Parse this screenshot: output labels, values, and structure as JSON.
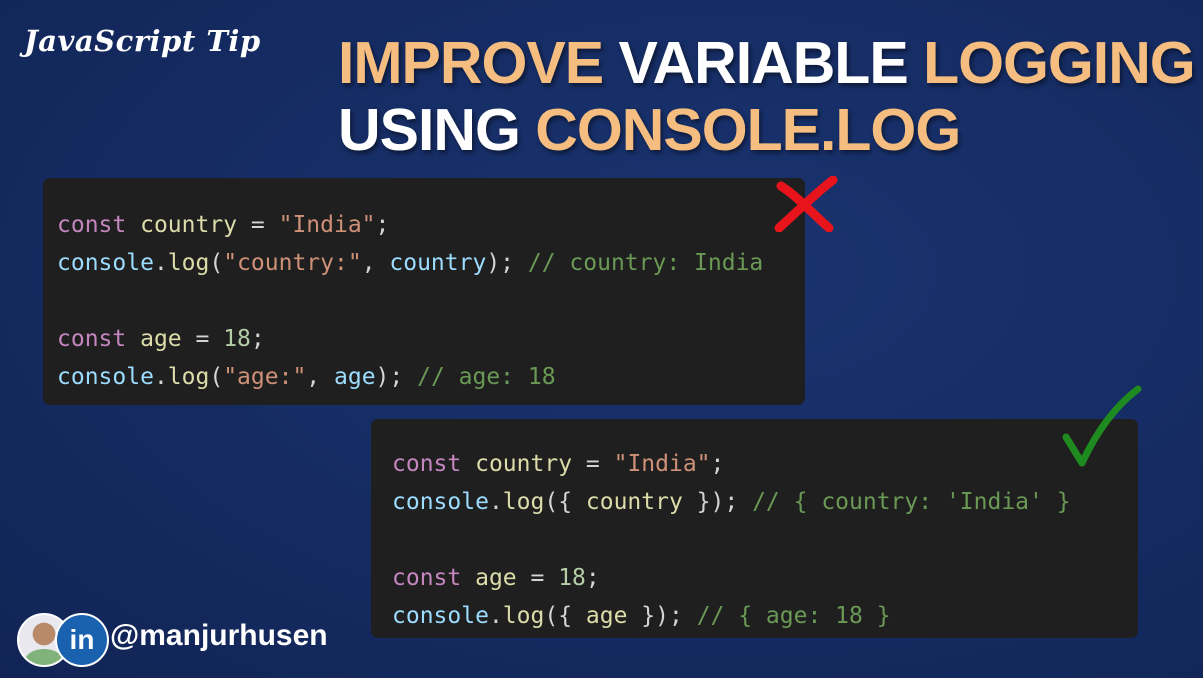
{
  "tag": "JavaScript Tip",
  "title": {
    "line1": [
      {
        "text": "IMPROVE ",
        "accent": true
      },
      {
        "text": "VARIABLE ",
        "accent": false
      },
      {
        "text": "LOGGING",
        "accent": true
      }
    ],
    "line2": [
      {
        "text": "USING ",
        "accent": false
      },
      {
        "text": "CONSOLE.LOG",
        "accent": true
      }
    ]
  },
  "bad_example": {
    "mark_icon": "red-cross-icon",
    "lines": [
      [
        [
          "kw",
          "const"
        ],
        [
          "pl",
          " "
        ],
        [
          "var",
          "country"
        ],
        [
          "pl",
          " = "
        ],
        [
          "str",
          "\"India\""
        ],
        [
          "pl",
          ";"
        ]
      ],
      [
        [
          "fn",
          "console"
        ],
        [
          "pl",
          "."
        ],
        [
          "var",
          "log"
        ],
        [
          "pl",
          "("
        ],
        [
          "str",
          "\"country:\""
        ],
        [
          "pl",
          ", "
        ],
        [
          "fn",
          "country"
        ],
        [
          "pl",
          "); "
        ],
        [
          "cm",
          "// country: India"
        ]
      ],
      [],
      [
        [
          "kw",
          "const"
        ],
        [
          "pl",
          " "
        ],
        [
          "var",
          "age"
        ],
        [
          "pl",
          " = "
        ],
        [
          "num",
          "18"
        ],
        [
          "pl",
          ";"
        ]
      ],
      [
        [
          "fn",
          "console"
        ],
        [
          "pl",
          "."
        ],
        [
          "var",
          "log"
        ],
        [
          "pl",
          "("
        ],
        [
          "str",
          "\"age:\""
        ],
        [
          "pl",
          ", "
        ],
        [
          "fn",
          "age"
        ],
        [
          "pl",
          "); "
        ],
        [
          "cm",
          "// age: 18"
        ]
      ]
    ]
  },
  "good_example": {
    "mark_icon": "green-check-icon",
    "lines": [
      [
        [
          "kw",
          "const"
        ],
        [
          "pl",
          " "
        ],
        [
          "var",
          "country"
        ],
        [
          "pl",
          " = "
        ],
        [
          "str",
          "\"India\""
        ],
        [
          "pl",
          ";"
        ]
      ],
      [
        [
          "fn",
          "console"
        ],
        [
          "pl",
          "."
        ],
        [
          "var",
          "log"
        ],
        [
          "pl",
          "({ "
        ],
        [
          "var",
          "country"
        ],
        [
          "pl",
          " }); "
        ],
        [
          "cm",
          "// { country: 'India' }"
        ]
      ],
      [],
      [
        [
          "kw",
          "const"
        ],
        [
          "pl",
          " "
        ],
        [
          "var",
          "age"
        ],
        [
          "pl",
          " = "
        ],
        [
          "num",
          "18"
        ],
        [
          "pl",
          ";"
        ]
      ],
      [
        [
          "fn",
          "console"
        ],
        [
          "pl",
          "."
        ],
        [
          "var",
          "log"
        ],
        [
          "pl",
          "({ "
        ],
        [
          "var",
          "age"
        ],
        [
          "pl",
          " }); "
        ],
        [
          "cm",
          "// { age: 18 }"
        ]
      ]
    ]
  },
  "author": {
    "avatar_icon": "profile-photo",
    "network_icon": "linkedin-icon",
    "network_label": "in",
    "handle": "@manjurhusen"
  },
  "colors": {
    "background": "#152b62",
    "accent": "#f5be80",
    "code_bg": "#1f1f1f",
    "cross": "#e8141c",
    "check": "#1f8a1f",
    "linkedin": "#1a62b0"
  }
}
